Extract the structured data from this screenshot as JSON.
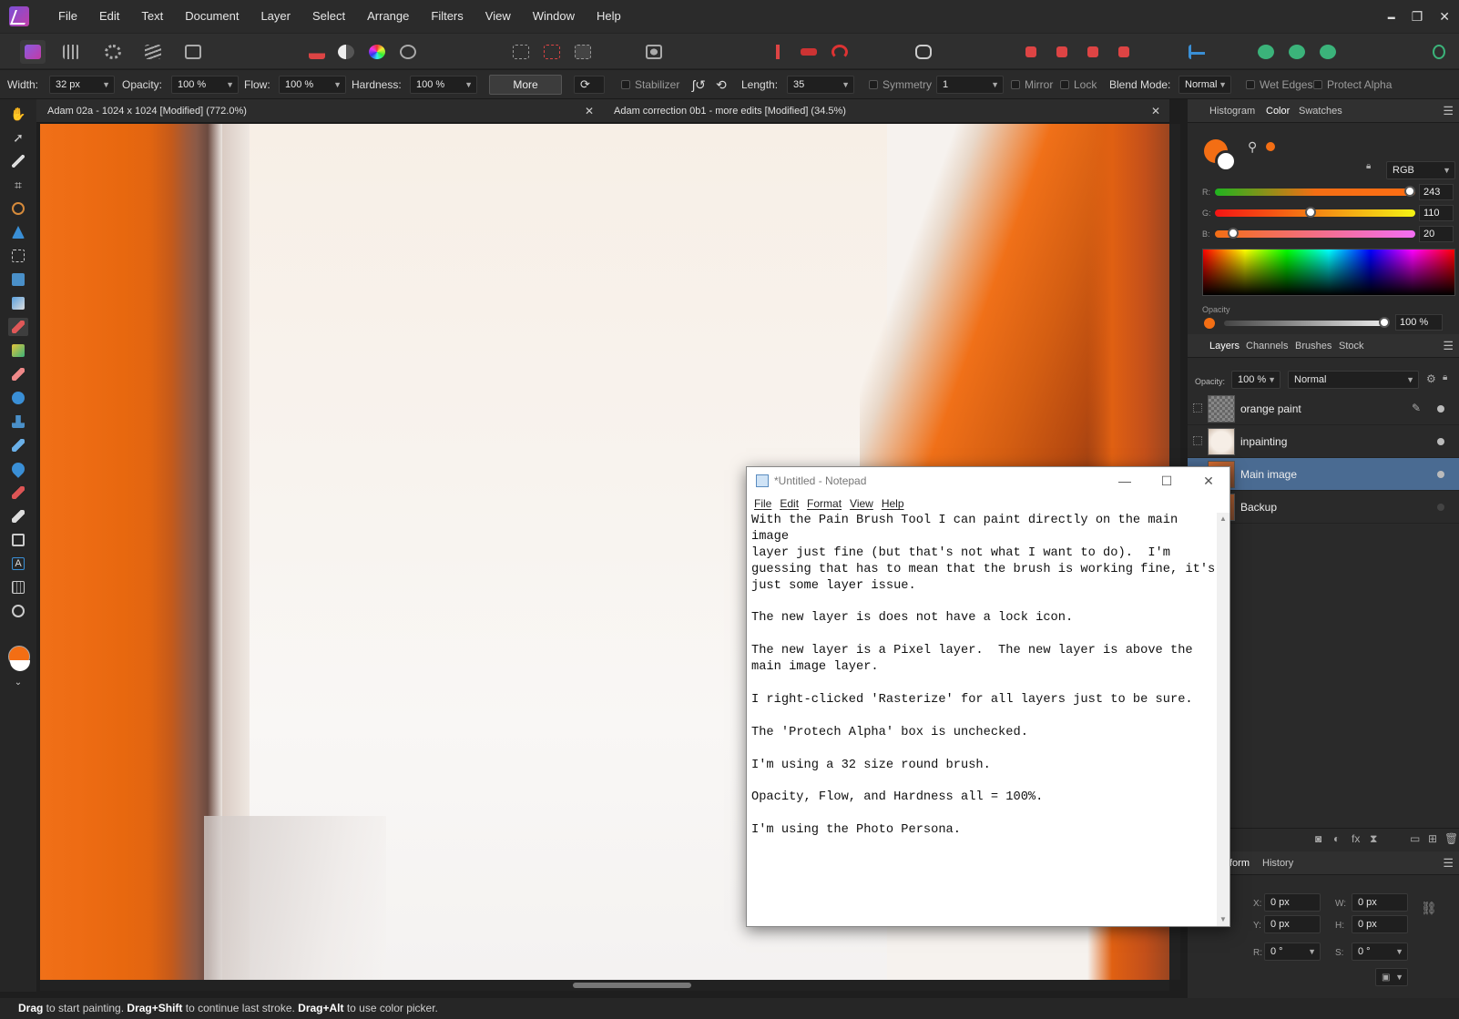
{
  "menu": [
    "File",
    "Edit",
    "Text",
    "Document",
    "Layer",
    "Select",
    "Arrange",
    "Filters",
    "View",
    "Window",
    "Help"
  ],
  "window_controls": {
    "minimize": "▬",
    "maximize": "❐",
    "close": "✕"
  },
  "context": {
    "width_label": "Width:",
    "width_value": "32 px",
    "opacity_label": "Opacity:",
    "opacity_value": "100 %",
    "flow_label": "Flow:",
    "flow_value": "100 %",
    "hardness_label": "Hardness:",
    "hardness_value": "100 %",
    "more_label": "More",
    "stabilizer_label": "Stabilizer",
    "length_label": "Length:",
    "length_value": "35",
    "symmetry_label": "Symmetry",
    "symmetry_value": "1",
    "mirror_label": "Mirror",
    "lock_label": "Lock",
    "blend_label": "Blend Mode:",
    "blend_value": "Normal",
    "wet_edges_label": "Wet Edges",
    "protect_alpha_label": "Protect Alpha"
  },
  "doc_tabs": [
    {
      "title": "Adam 02a - 1024 x 1024 [Modified] (772.0%)"
    },
    {
      "title": "Adam correction 0b1 - more edits [Modified] (34.5%)"
    }
  ],
  "color_panel": {
    "tabs": [
      "Histogram",
      "Color",
      "Swatches"
    ],
    "model": "RGB",
    "r_label": "R:",
    "r_value": "243",
    "g_label": "G:",
    "g_value": "110",
    "b_label": "B:",
    "b_value": "20",
    "opacity_label": "Opacity",
    "opacity_value": "100 %",
    "primary_color": "#f36e14"
  },
  "layers_panel": {
    "tabs": [
      "Layers",
      "Channels",
      "Brushes",
      "Stock"
    ],
    "opacity_label": "Opacity:",
    "opacity_value": "100 %",
    "blend_value": "Normal",
    "layers": [
      {
        "name": "orange paint"
      },
      {
        "name": "inpainting"
      },
      {
        "name": "Main image"
      },
      {
        "name": "Backup"
      }
    ]
  },
  "transform_panel": {
    "tabs": [
      "form",
      "History"
    ],
    "x_label": "X:",
    "x_value": "0 px",
    "y_label": "Y:",
    "y_value": "0 px",
    "w_label": "W:",
    "w_value": "0 px",
    "h_label": "H:",
    "h_value": "0 px",
    "r_label": "R:",
    "r_value": "0 °",
    "s_label": "S:",
    "s_value": "0 °"
  },
  "status": {
    "drag": "Drag",
    "t1": " to start painting. ",
    "drag_shift": "Drag+Shift",
    "t2": " to continue last stroke. ",
    "drag_alt": "Drag+Alt",
    "t3": " to use color picker."
  },
  "notepad": {
    "title": "*Untitled - Notepad",
    "menu": [
      "File",
      "Edit",
      "Format",
      "View",
      "Help"
    ],
    "text": "With the Pain Brush Tool I can paint directly on the main image\nlayer just fine (but that's not what I want to do).  I'm\nguessing that has to mean that the brush is working fine, it's\njust some layer issue.\n\nThe new layer is does not have a lock icon.\n\nThe new layer is a Pixel layer.  The new layer is above the\nmain image layer.\n\nI right-clicked 'Rasterize' for all layers just to be sure.\n\nThe 'Protech Alpha' box is unchecked.\n\nI'm using a 32 size round brush.\n\nOpacity, Flow, and Hardness all = 100%.\n\nI'm using the Photo Persona."
  }
}
